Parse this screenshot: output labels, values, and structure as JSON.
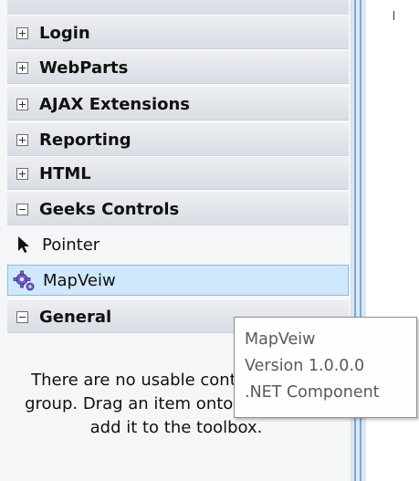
{
  "toolbox": {
    "categories": [
      {
        "label": "Login",
        "expanded": false
      },
      {
        "label": "WebParts",
        "expanded": false
      },
      {
        "label": "AJAX Extensions",
        "expanded": false
      },
      {
        "label": "Reporting",
        "expanded": false
      },
      {
        "label": "HTML",
        "expanded": false
      },
      {
        "label": "Geeks Controls",
        "expanded": true
      },
      {
        "label": "General",
        "expanded": true
      }
    ],
    "geeks_items": [
      {
        "label": "Pointer",
        "icon": "pointer-icon"
      },
      {
        "label": "MapVeiw",
        "icon": "gear-icon",
        "selected": true
      }
    ],
    "general_empty_text": "There are no usable controls in this group. Drag an item onto this text to add it to the toolbox."
  },
  "tooltip": {
    "line1": "MapVeiw",
    "line2": "Version 1.0.0.0",
    "line3": ".NET Component"
  },
  "colors": {
    "selected_bg": "#cfe8fb",
    "selected_border": "#7ac0ec"
  }
}
